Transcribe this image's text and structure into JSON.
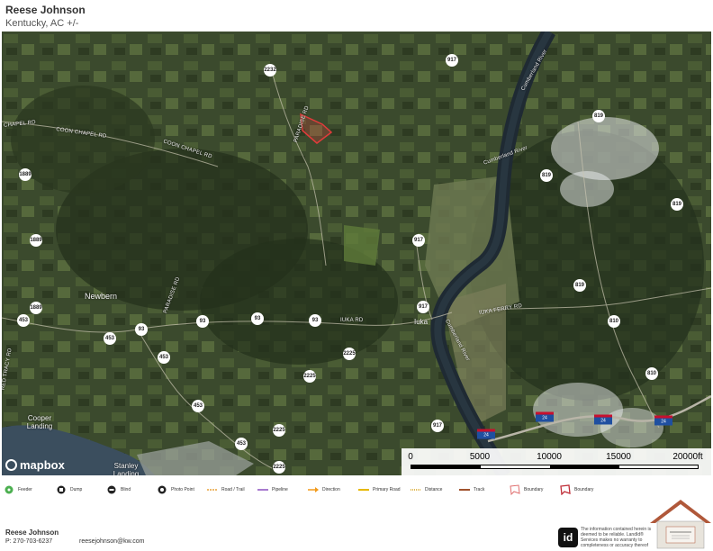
{
  "header": {
    "agent_name": "Reese Johnson",
    "location": "Kentucky,  AC +/-"
  },
  "map": {
    "route_shields": [
      "2232",
      "917",
      "819",
      "1889",
      "819",
      "819",
      "1889",
      "917",
      "819",
      "1889",
      "93",
      "93",
      "93",
      "93",
      "917",
      "810",
      "453",
      "453",
      "453",
      "453",
      "2225",
      "2225",
      "810",
      "917",
      "2225",
      "453",
      "2225"
    ],
    "interstate_shields": [
      "24",
      "24",
      "24",
      "24"
    ],
    "road_labels": [
      "COON CHAPEL RD",
      "COON CHAPEL RD",
      "CHAPEL RD",
      "PARADISE RD",
      "PARADISE RD",
      "IUKA RD",
      "IUKA FERRY RD",
      "RED TRACY RD",
      "Cumberland River",
      "Cumberland River",
      "Cumberland River"
    ],
    "places": [
      "Newbern",
      "Iuka",
      "Cooper Landing",
      "Stanley Landing"
    ],
    "attribution_logo": "mapbox",
    "scale": {
      "labels": [
        "0",
        "5000",
        "10000",
        "15000",
        "20000ft"
      ]
    }
  },
  "legend": {
    "items": [
      {
        "label": "Feeder",
        "icon": "feeder-icon",
        "color": "#4caf50"
      },
      {
        "label": "Dump",
        "icon": "dump-icon",
        "color": "#222222"
      },
      {
        "label": "Blind",
        "icon": "blind-icon",
        "color": "#222222"
      },
      {
        "label": "Photo Point",
        "icon": "camera-icon",
        "color": "#222222"
      },
      {
        "label": "Road / Trail",
        "icon": "road-trail-line",
        "color": "#e8a23a"
      },
      {
        "label": "Pipeline",
        "icon": "pipeline-line",
        "color": "#8a4fbf"
      },
      {
        "label": "Direction",
        "icon": "direction-arrow",
        "color": "#f29a1a"
      },
      {
        "label": "Primary Road",
        "icon": "primary-road-line",
        "color": "#e6b800"
      },
      {
        "label": "Distance",
        "icon": "distance-line",
        "color": "#d7a21a"
      },
      {
        "label": "Track",
        "icon": "track-line",
        "color": "#a0522d"
      },
      {
        "label": "Boundary",
        "icon": "boundary-icon",
        "color": "#e07070"
      },
      {
        "label": "Boundary",
        "icon": "boundary-icon",
        "color": "#c0303a"
      }
    ]
  },
  "footer": {
    "name": "Reese Johnson",
    "phone": "P: 270-703-6237",
    "email": "reesejohnson@kw.com",
    "id_logo": "id",
    "disclaimer": "The information contained herein is deemed to be reliable. LandId® Services makes no warranty to completeness or accuracy thereof"
  },
  "colors": {
    "boundary": "#e23b3b",
    "river": "#22303a",
    "interstate_blue": "#1f4fa0",
    "interstate_red": "#c8102e"
  }
}
